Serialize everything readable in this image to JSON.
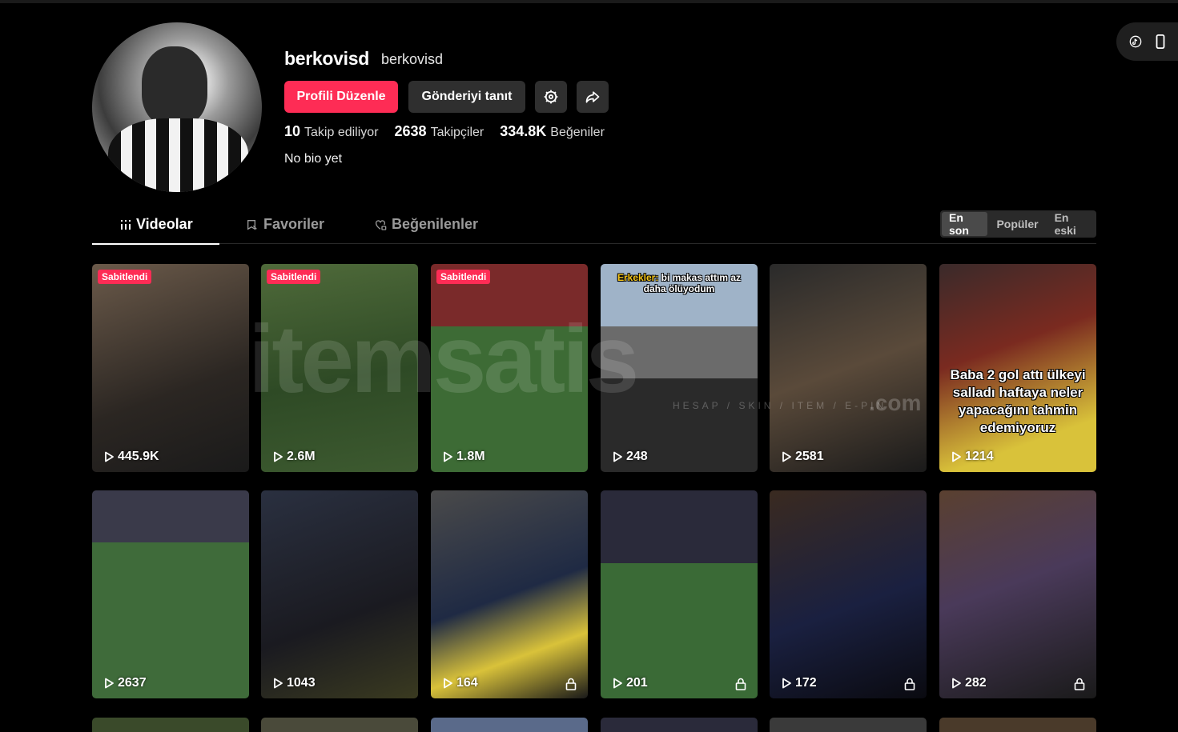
{
  "profile": {
    "username": "berkovisd",
    "nickname": "berkovisd",
    "edit_label": "Profili Düzenle",
    "promote_label": "Gönderiyi tanıt",
    "following_count": "10",
    "following_label": "Takip ediliyor",
    "followers_count": "2638",
    "followers_label": "Takipçiler",
    "likes_count": "334.8K",
    "likes_label": "Beğeniler",
    "bio": "No bio yet"
  },
  "tabs": {
    "videos": "Videolar",
    "favorites": "Favoriler",
    "liked": "Beğenilenler"
  },
  "sort": {
    "latest": "En son",
    "popular": "Popüler",
    "oldest": "En eski"
  },
  "watermark": {
    "brand": "itemsatis",
    "sub": "HESAP / SKIN / ITEM / E-PIN",
    "com": ".com"
  },
  "colors": {
    "accent": "#fe2c55",
    "background": "#000000"
  },
  "pinned_label": "Sabitlendi",
  "videos": [
    {
      "views": "445.9K",
      "pinned": true
    },
    {
      "views": "2.6M",
      "pinned": true
    },
    {
      "views": "1.8M",
      "pinned": true
    },
    {
      "views": "248",
      "caption_hl": "Erkekler:",
      "caption": "bi makas attım az daha ölüyodum"
    },
    {
      "views": "2581"
    },
    {
      "views": "1214",
      "caption": "Baba 2 gol attı ülkeyi salladı haftaya neler yapacağını tahmin edemiyoruz"
    },
    {
      "views": "2637"
    },
    {
      "views": "1043"
    },
    {
      "views": "164",
      "private": true
    },
    {
      "views": "201",
      "private": true
    },
    {
      "views": "172",
      "private": true
    },
    {
      "views": "282",
      "private": true
    }
  ]
}
